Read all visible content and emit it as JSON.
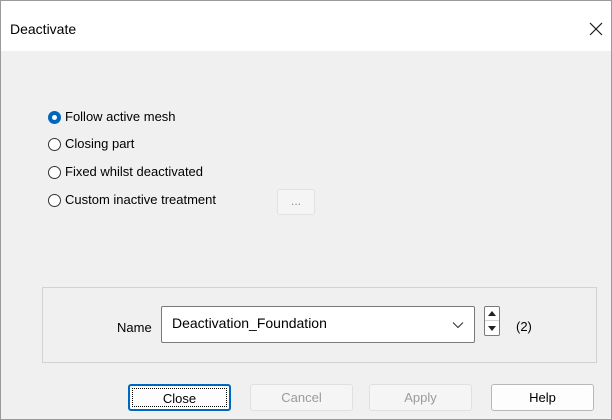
{
  "window": {
    "title": "Deactivate"
  },
  "options": [
    {
      "label": "Follow active mesh",
      "checked": true
    },
    {
      "label": "Closing part",
      "checked": false
    },
    {
      "label": "Fixed whilst deactivated",
      "checked": false
    },
    {
      "label": "Custom inactive treatment",
      "checked": false
    }
  ],
  "custom_button_label": "...",
  "name_field": {
    "label": "Name",
    "value": "Deactivation_Foundation",
    "count": "(2)"
  },
  "buttons": {
    "close": "Close",
    "cancel": "Cancel",
    "apply": "Apply",
    "help": "Help"
  },
  "icons": {
    "close": "close-icon",
    "dropdown": "chevron-down-icon",
    "spin_up": "triangle-up-icon",
    "spin_down": "triangle-down-icon"
  },
  "colors": {
    "accent": "#0067c0",
    "dialog_bg": "#f0f0f0",
    "titlebar_bg": "#ffffff",
    "disabled_text": "#9b9b9b"
  }
}
